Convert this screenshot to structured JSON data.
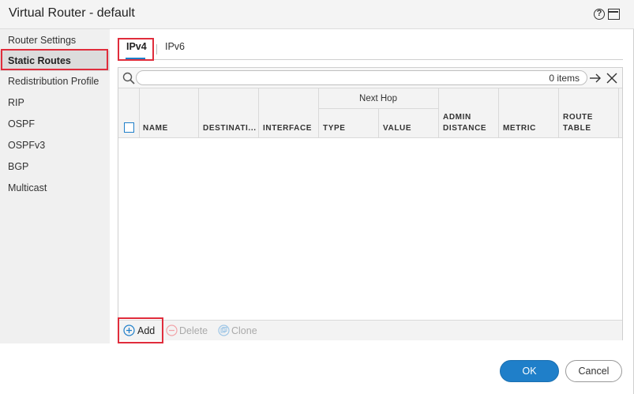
{
  "window": {
    "title": "Virtual Router - default"
  },
  "sidebar": {
    "items": [
      {
        "label": "Router Settings"
      },
      {
        "label": "Static Routes"
      },
      {
        "label": "Redistribution Profile"
      },
      {
        "label": "RIP"
      },
      {
        "label": "OSPF"
      },
      {
        "label": "OSPFv3"
      },
      {
        "label": "BGP"
      },
      {
        "label": "Multicast"
      }
    ],
    "active": "Static Routes"
  },
  "tabs": [
    {
      "label": "IPv4"
    },
    {
      "label": "IPv6"
    }
  ],
  "search": {
    "placeholder": "",
    "value": "",
    "count": "0 items"
  },
  "table": {
    "group_header": "Next Hop",
    "columns": {
      "name": "NAME",
      "destination": "DESTINATI...",
      "interface": "INTERFACE",
      "type": "TYPE",
      "value": "VALUE",
      "admin_distance_1": "ADMIN",
      "admin_distance_2": "DISTANCE",
      "metric": "METRIC",
      "route_table_1": "ROUTE",
      "route_table_2": "TABLE"
    },
    "rows": []
  },
  "toolbar": {
    "add": "Add",
    "delete": "Delete",
    "clone": "Clone"
  },
  "footer": {
    "ok": "OK",
    "cancel": "Cancel"
  },
  "colors": {
    "accent": "#1f7fc9",
    "highlight": "#e02d3c"
  },
  "icons": [
    "help-icon",
    "maximize-icon",
    "search-icon",
    "arrow-right-icon",
    "close-icon",
    "add-icon",
    "delete-icon",
    "clone-icon"
  ]
}
